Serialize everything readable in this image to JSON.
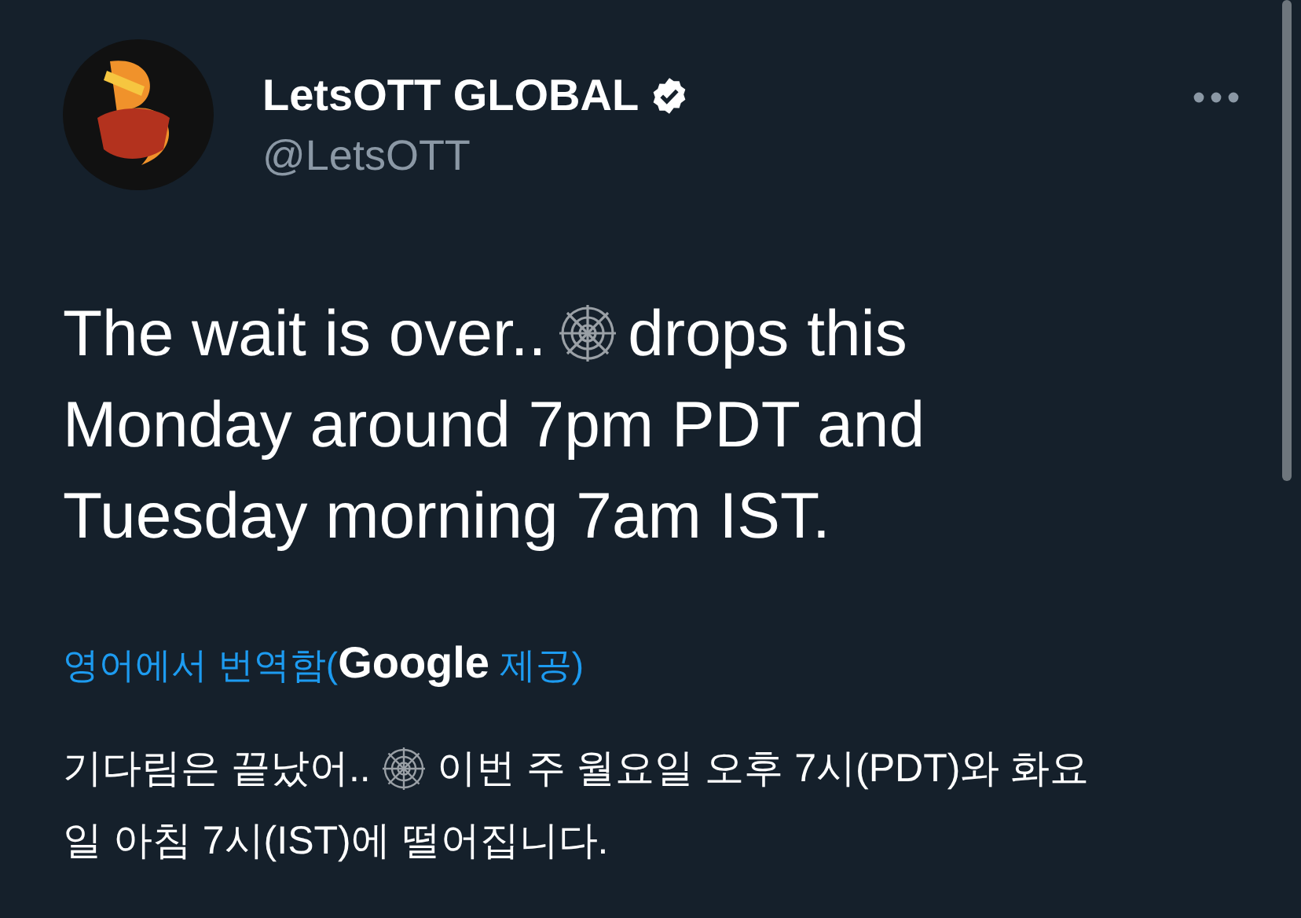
{
  "author": {
    "name": "LetsOTT GLOBAL",
    "verified": true,
    "handle": "@LetsOTT"
  },
  "tweet": {
    "lines": [
      [
        {
          "kind": "text",
          "text": "The wait is over.."
        },
        {
          "kind": "web-emoji"
        },
        {
          "kind": "text",
          "text": "drops this"
        }
      ],
      [
        {
          "kind": "text",
          "text": "Monday around 7pm PDT and"
        }
      ],
      [
        {
          "kind": "text",
          "text": "Tuesday morning 7am IST."
        }
      ]
    ]
  },
  "translation_label": {
    "prefix": "영어에서 번역함(",
    "provider": "Google",
    "suffix": " 제공)"
  },
  "translation": {
    "lines": [
      [
        {
          "kind": "text",
          "text": "기다림은 끝났어.."
        },
        {
          "kind": "web-emoji"
        },
        {
          "kind": "text",
          "text": "이번 주 월요일 오후 7시(PDT)와 화요"
        }
      ],
      [
        {
          "kind": "text",
          "text": "일 아침 7시(IST)에 떨어집니다."
        }
      ]
    ]
  }
}
